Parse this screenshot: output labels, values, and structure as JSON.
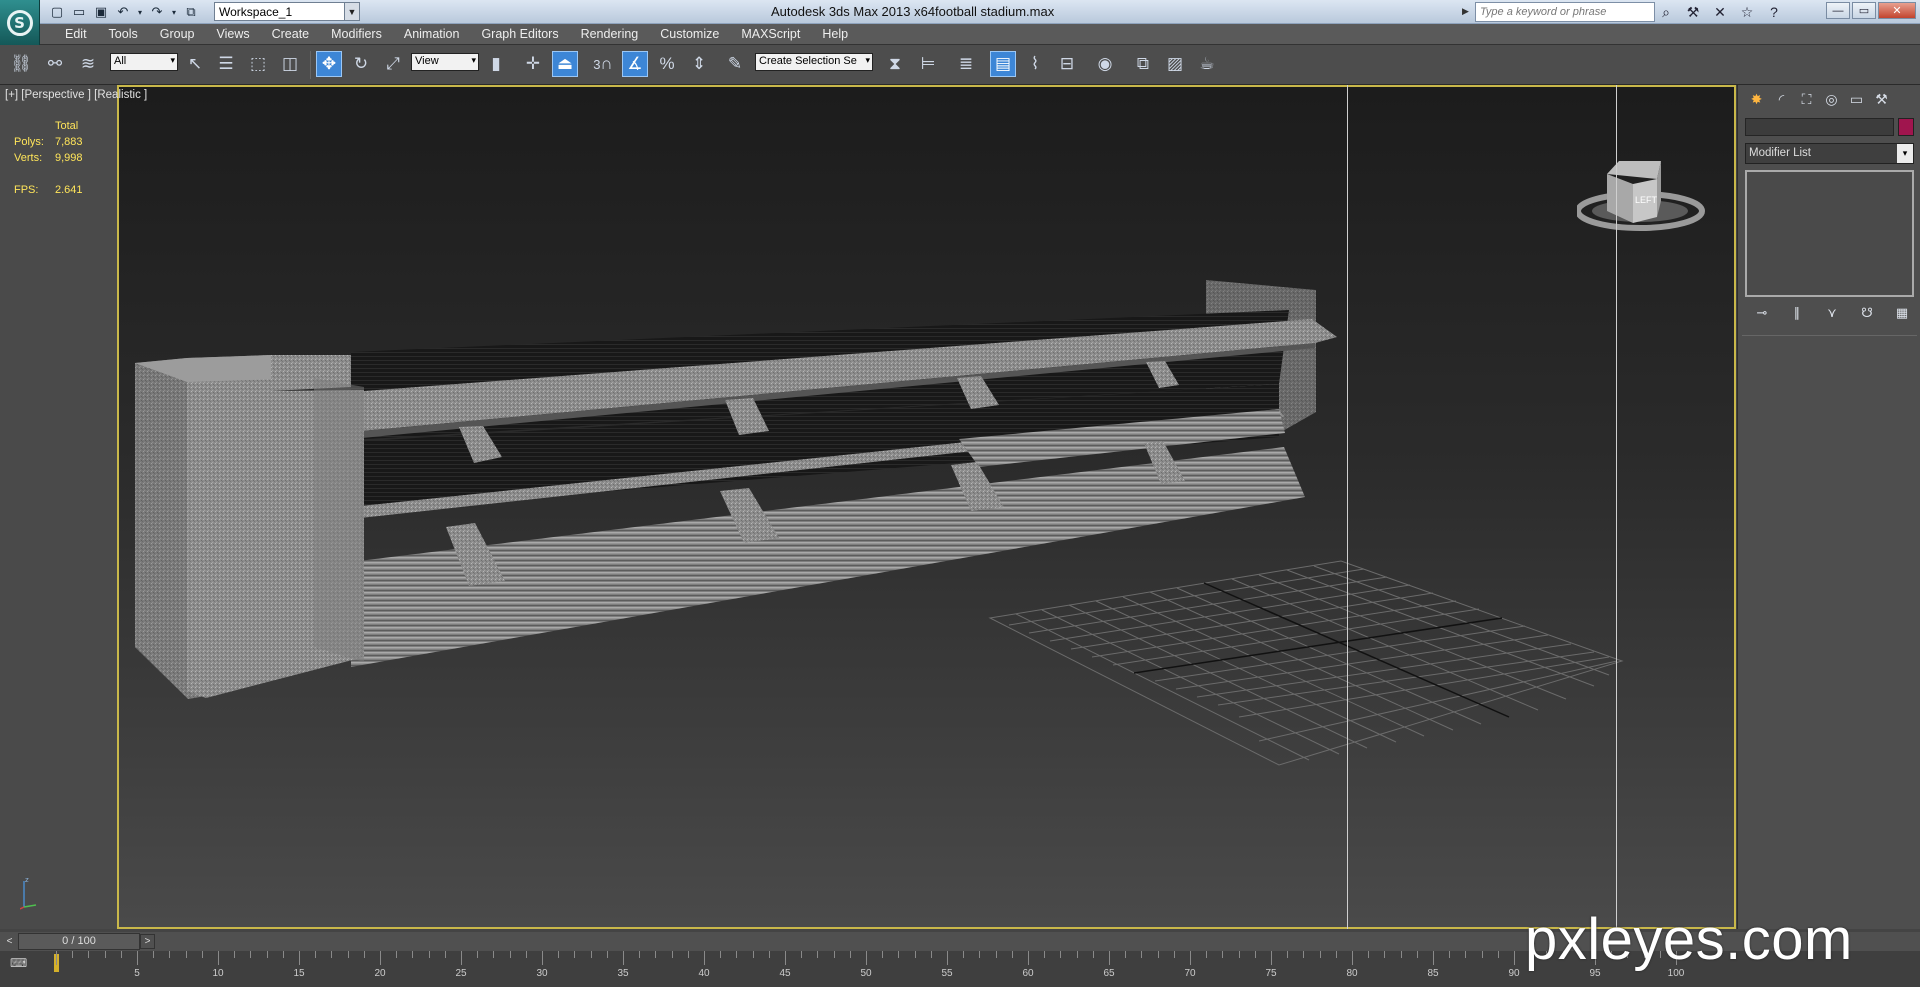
{
  "titlebar": {
    "app_title": "Autodesk 3ds Max  2013 x64",
    "file_name": "football stadium.max",
    "workspace": "Workspace_1",
    "search_placeholder": "Type a keyword or phrase"
  },
  "menu": {
    "items": [
      "Edit",
      "Tools",
      "Group",
      "Views",
      "Create",
      "Modifiers",
      "Animation",
      "Graph Editors",
      "Rendering",
      "Customize",
      "MAXScript",
      "Help"
    ]
  },
  "toolbar": {
    "selection_filter": "All",
    "reference_coord": "View",
    "named_selection": "Create Selection Se",
    "snap_label": "3"
  },
  "viewport": {
    "label": "[+] [Perspective ] [Realistic ]",
    "stats": {
      "header": "Total",
      "polys_label": "Polys:",
      "polys_value": "7,883",
      "verts_label": "Verts:",
      "verts_value": "9,998",
      "fps_label": "FPS:",
      "fps_value": "2.641"
    },
    "viewcube_face": "LEFT"
  },
  "command_panel": {
    "modifier_list": "Modifier List",
    "object_color": "#a0154e"
  },
  "timeline": {
    "frame_readout": "0 / 100",
    "ticks": [
      5,
      10,
      15,
      20,
      25,
      30,
      35,
      40,
      45,
      50,
      55,
      60,
      65,
      70,
      75,
      80,
      85,
      90,
      95,
      100
    ]
  },
  "watermark": "pxleyes.com"
}
